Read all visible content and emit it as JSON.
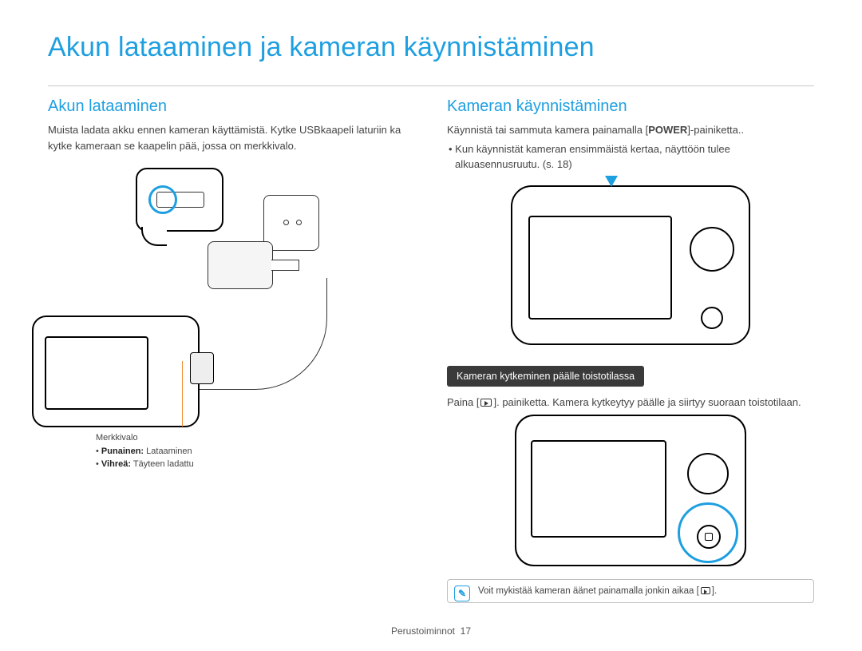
{
  "title": "Akun lataaminen ja kameran käynnistäminen",
  "left": {
    "heading": "Akun lataaminen",
    "para": "Muista ladata akku ennen kameran käyttämistä. Kytke USBkaapeli laturiin ka kytke kameraan se kaapelin pää, jossa on merkkivalo.",
    "legend_title": "Merkkivalo",
    "legend_red_label": "Punainen:",
    "legend_red_text": " Lataaminen",
    "legend_green_label": "Vihreä:",
    "legend_green_text": " Täyteen ladattu"
  },
  "right": {
    "heading": "Kameran käynnistäminen",
    "para_pre": "Käynnistä tai sammuta kamera painamalla [",
    "para_bold": "POWER",
    "para_post": "]-painiketta..",
    "bullet": "Kun käynnistät kameran ensimmäistä kertaa, näyttöön tulee alkuasennusruutu. (s. 18)",
    "band": "Kameran kytkeminen päälle toistotilassa",
    "press_pre": "Paina [",
    "press_post": "]. painiketta. Kamera kytkeytyy päälle ja siirtyy suoraan toistotilaan.",
    "note": "Voit mykistää kameran äänet painamalla jonkin aikaa [",
    "note_post": "]."
  },
  "footer": {
    "section": "Perustoiminnot",
    "page": "17"
  }
}
